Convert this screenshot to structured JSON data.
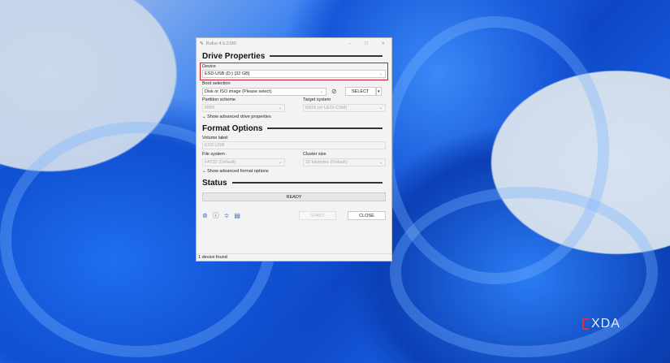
{
  "window": {
    "title": "Rufus 4.5.2180"
  },
  "drive": {
    "heading": "Drive Properties",
    "device_label": "Device",
    "device_value": "ESD-USB (D:) [32 GB]",
    "boot_label": "Boot selection",
    "boot_value": "Disk or ISO image (Please select)",
    "select_button": "SELECT",
    "partition_label": "Partition scheme",
    "partition_value": "MBR",
    "target_label": "Target system",
    "target_value": "BIOS (or UEFI-CSM)",
    "advanced": "Show advanced drive properties"
  },
  "format": {
    "heading": "Format Options",
    "volume_label": "Volume label",
    "volume_value": "ESD-USB",
    "fs_label": "File system",
    "fs_value": "FAT32 (Default)",
    "cluster_label": "Cluster size",
    "cluster_value": "16 kilobytes (Default)",
    "advanced": "Show advanced format options"
  },
  "status": {
    "heading": "Status",
    "progress_text": "READY",
    "progress": 0,
    "start": "START",
    "close": "CLOSE",
    "footer": "1 device found"
  },
  "watermark": "XDA",
  "colors": {
    "highlight": "#d0202a"
  }
}
